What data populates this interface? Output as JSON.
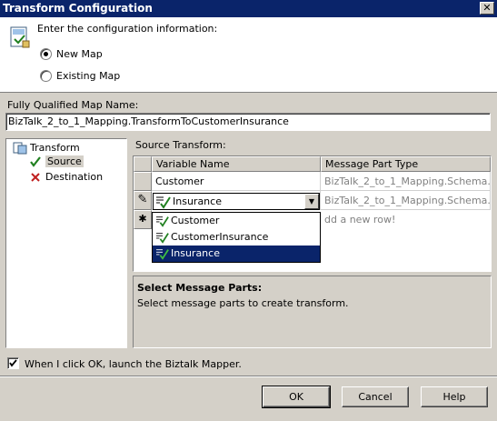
{
  "window": {
    "title": "Transform Configuration",
    "close_glyph": "✕"
  },
  "header": {
    "prompt": "Enter the configuration information:",
    "options": [
      {
        "label": "New Map",
        "checked": true
      },
      {
        "label": "Existing Map",
        "checked": false
      }
    ]
  },
  "map_name": {
    "label": "Fully Qualified Map Name:",
    "value": "BizTalk_2_to_1_Mapping.TransformToCustomerInsurance"
  },
  "tree": {
    "root": "Transform",
    "items": [
      {
        "label": "Source",
        "icon": "check-icon",
        "selected": true
      },
      {
        "label": "Destination",
        "icon": "x-icon",
        "selected": false
      }
    ]
  },
  "source_transform": {
    "label": "Source Transform:",
    "columns": [
      "Variable Name",
      "Message Part Type"
    ],
    "rows": [
      {
        "variable": "Customer",
        "type": "BizTalk_2_to_1_Mapping.Schema..."
      },
      {
        "variable": "Insurance",
        "type": "BizTalk_2_to_1_Mapping.Schema...",
        "editing": true
      }
    ],
    "new_row_text": "dd a new row!",
    "row_markers": {
      "editing": "✎",
      "new": "✱"
    }
  },
  "dropdown": {
    "items": [
      "Customer",
      "CustomerInsurance",
      "Insurance"
    ],
    "selected_index": 2
  },
  "info": {
    "title": "Select Message Parts:",
    "text": "Select message parts to create transform."
  },
  "launch_mapper": {
    "label": "When I click OK, launch the Biztalk Mapper.",
    "checked": true
  },
  "buttons": {
    "ok": "OK",
    "cancel": "Cancel",
    "help": "Help"
  }
}
